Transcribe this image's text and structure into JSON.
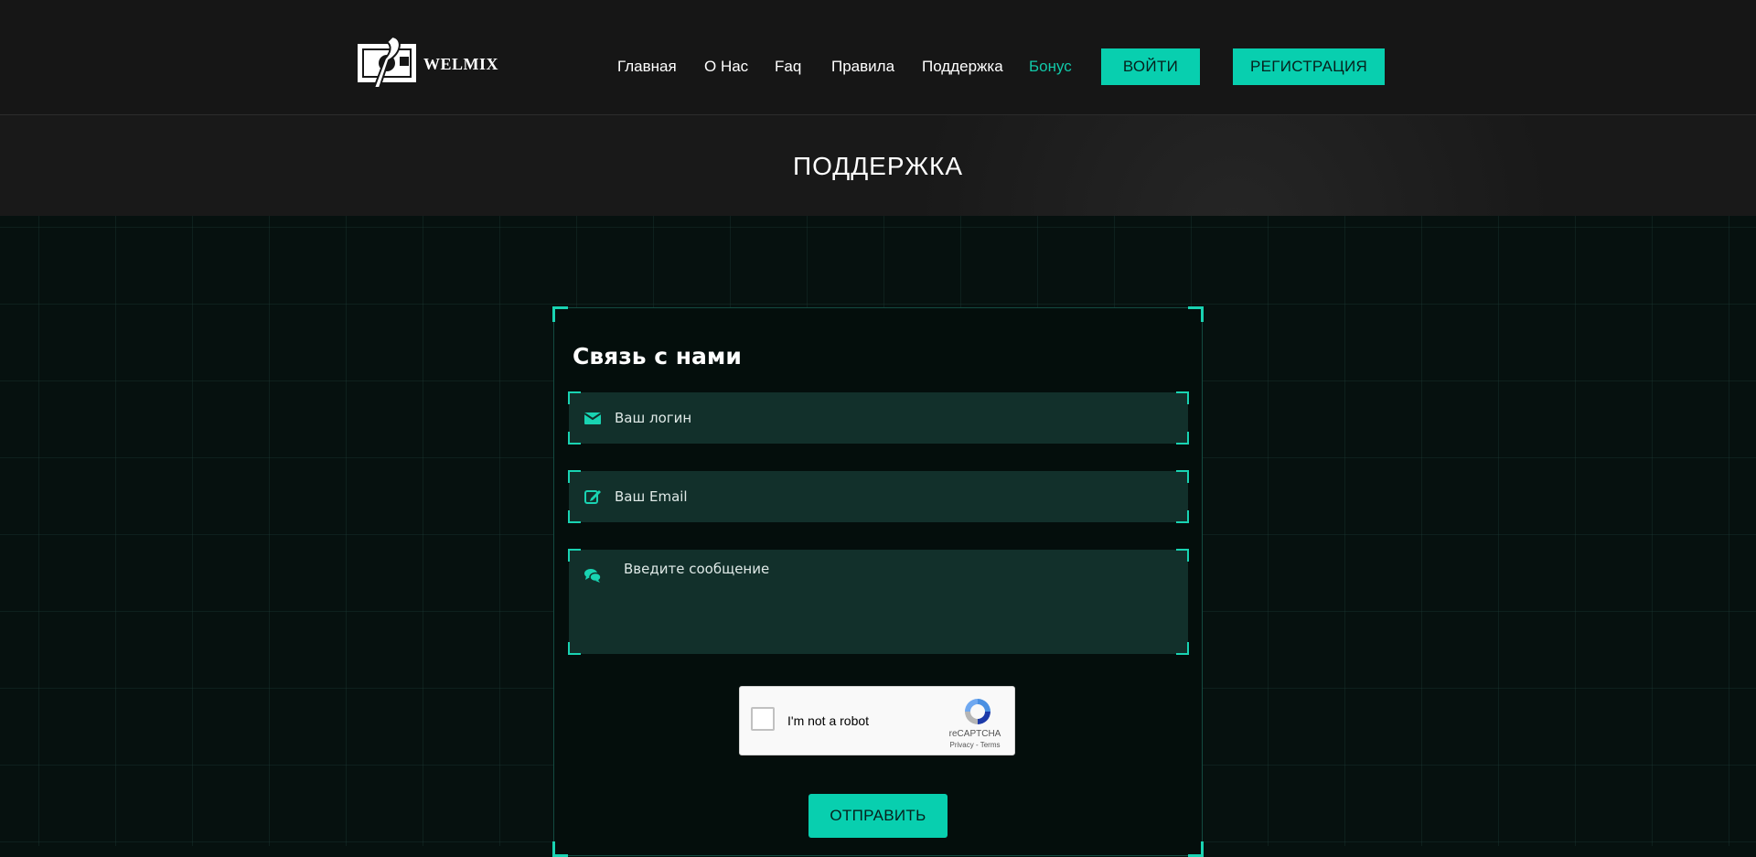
{
  "brand": {
    "logo_text": "WELMIX"
  },
  "nav": {
    "items": [
      {
        "label": "Главная"
      },
      {
        "label": "О Нас"
      },
      {
        "label": "Faq"
      },
      {
        "label": "Правила"
      },
      {
        "label": "Поддержка"
      },
      {
        "label": "Бонус"
      }
    ],
    "login_label": "ВОЙТИ",
    "register_label": "РЕГИСТРАЦИЯ"
  },
  "page": {
    "title": "ПОДДЕРЖКА"
  },
  "form": {
    "title": "Связь с нами",
    "login_placeholder": "Ваш логин",
    "email_placeholder": "Ваш Email",
    "message_placeholder": "Введите сообщение",
    "submit_label": "ОТПРАВИТЬ"
  },
  "captcha": {
    "label": "I'm not a robot",
    "brand": "reCAPTCHA",
    "terms": "Privacy - Terms"
  },
  "colors": {
    "accent": "#08cfaf",
    "active_nav": "#12c8a9",
    "background": "#06110f",
    "header": "#161616"
  },
  "icons": [
    "envelope-icon",
    "edit-icon",
    "comments-icon",
    "recaptcha-icon"
  ]
}
